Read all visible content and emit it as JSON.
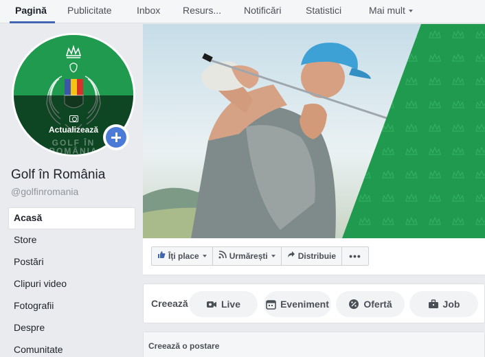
{
  "tabs": [
    {
      "label": "Pagină"
    },
    {
      "label": "Publicitate"
    },
    {
      "label": "Inbox"
    },
    {
      "label": "Resurs..."
    },
    {
      "label": "Notificări"
    },
    {
      "label": "Statistici"
    },
    {
      "label": "Mai mult"
    }
  ],
  "profile": {
    "update_label": "Actualizează",
    "name": "Golf în România",
    "handle": "@golfinromania",
    "logo_text_1": "GOLF ÎN",
    "logo_text_2": "ROMÂNIA"
  },
  "nav": [
    {
      "label": "Acasă"
    },
    {
      "label": "Store"
    },
    {
      "label": "Postări"
    },
    {
      "label": "Clipuri video"
    },
    {
      "label": "Fotografii"
    },
    {
      "label": "Despre"
    },
    {
      "label": "Comunitate"
    }
  ],
  "actions": {
    "like": "Îți place",
    "follow": "Urmărești",
    "share": "Distribuie",
    "more": "•••"
  },
  "create": {
    "label": "Creează",
    "live": "Live",
    "event": "Eveniment",
    "offer": "Ofertă",
    "job": "Job"
  },
  "post": {
    "label": "Creează o postare"
  },
  "colors": {
    "accent": "#4267b2",
    "brand_green": "#1f9a4e"
  }
}
